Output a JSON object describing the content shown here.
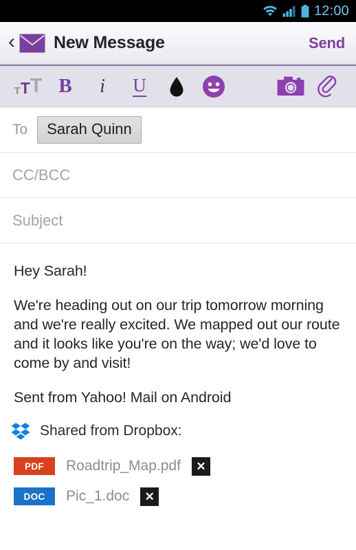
{
  "statusbar": {
    "clock": "12:00",
    "icons": [
      "wifi-icon",
      "signal-bars-icon",
      "battery-icon"
    ]
  },
  "header": {
    "back_icon": "back-chevron-icon",
    "app_icon": "envelope-icon",
    "title": "New Message",
    "send_label": "Send"
  },
  "toolbar": {
    "items": [
      {
        "name": "font-size-icon",
        "label": "TT"
      },
      {
        "name": "bold-icon",
        "label": "B"
      },
      {
        "name": "italic-icon",
        "label": "i"
      },
      {
        "name": "underline-icon",
        "label": "U"
      },
      {
        "name": "text-color-icon",
        "label": "ink-drop"
      },
      {
        "name": "emoji-icon",
        "label": "smiley"
      },
      {
        "name": "camera-icon",
        "label": "camera"
      },
      {
        "name": "attach-icon",
        "label": "paperclip"
      }
    ]
  },
  "compose": {
    "to_label": "To",
    "to_chip": "Sarah Quinn",
    "ccbcc_placeholder": "CC/BCC",
    "subject_placeholder": "Subject",
    "body": [
      "Hey Sarah!",
      "We're heading out on our trip tomorrow morning and we're really excited. We mapped out our route and it looks like you're on the way; we'd love to come by and visit!",
      "Sent from Yahoo! Mail on Android"
    ]
  },
  "dropbox": {
    "logo_icon": "dropbox-icon",
    "heading": "Shared from Dropbox:",
    "attachments": [
      {
        "type": "PDF",
        "name": "Roadtrip_Map.pdf",
        "color": "#d9411e",
        "remove": "✕"
      },
      {
        "type": "DOC",
        "name": "Pic_1.doc",
        "color": "#1a73c8",
        "remove": "✕"
      }
    ]
  },
  "colors": {
    "accent_purple": "#7e3f9d",
    "status_blue": "#6ec6f0",
    "toolbar_bg": "#e2e1ea",
    "dropbox_blue": "#1081de"
  }
}
